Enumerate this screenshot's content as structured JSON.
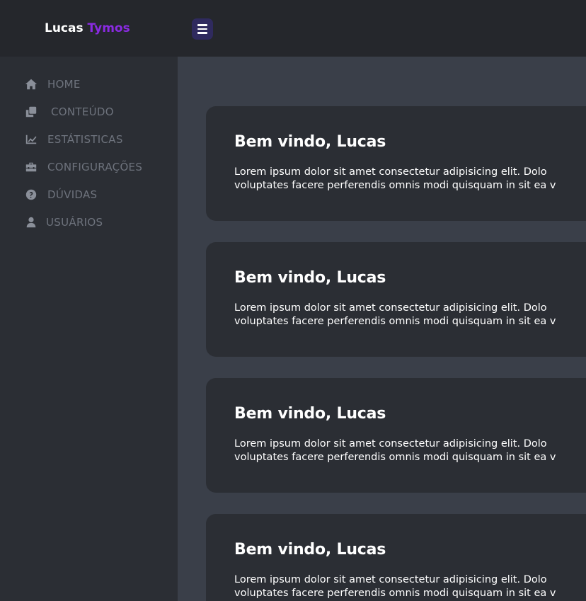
{
  "brand": {
    "first": "Lucas",
    "second": "Tymos",
    "accent_color": "#8a2be2"
  },
  "header": {
    "menu_icon": "hamburger-menu-icon"
  },
  "sidebar": {
    "items": [
      {
        "label": "HOME",
        "icon": "home-icon"
      },
      {
        "label": "CONTEÚDO",
        "icon": "copy-icon"
      },
      {
        "label": "ESTÁTISTICAS",
        "icon": "chart-line-icon"
      },
      {
        "label": "CONFIGURAÇÕES",
        "icon": "toolbox-icon"
      },
      {
        "label": "DÚVIDAS",
        "icon": "question-circle-icon"
      },
      {
        "label": "USUÁRIOS",
        "icon": "user-icon"
      }
    ]
  },
  "cards": [
    {
      "title": "Bem vindo, Lucas",
      "line1": "Lorem ipsum dolor sit amet consectetur adipisicing elit. Dolo",
      "line2": "voluptates facere perferendis omnis modi quisquam in sit ea v"
    },
    {
      "title": "Bem vindo, Lucas",
      "line1": "Lorem ipsum dolor sit amet consectetur adipisicing elit. Dolo",
      "line2": "voluptates facere perferendis omnis modi quisquam in sit ea v"
    },
    {
      "title": "Bem vindo, Lucas",
      "line1": "Lorem ipsum dolor sit amet consectetur adipisicing elit. Dolo",
      "line2": "voluptates facere perferendis omnis modi quisquam in sit ea v"
    },
    {
      "title": "Bem vindo, Lucas",
      "line1": "Lorem ipsum dolor sit amet consectetur adipisicing elit. Dolo",
      "line2": "voluptates facere perferendis omnis modi quisquam in sit ea v"
    }
  ]
}
